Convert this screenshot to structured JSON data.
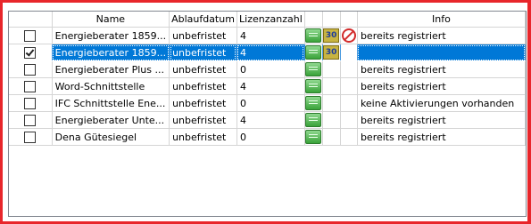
{
  "columns": {
    "check": "",
    "name": "Name",
    "ablaufdatum": "Ablaufdatum",
    "lizenzanzahl": "Lizenzanzahl",
    "icons": "",
    "info": "Info"
  },
  "rows": [
    {
      "checked": false,
      "name": "Energieberater 1859...",
      "ablaufdatum": "unbefristet",
      "lizenzanzahl": "4",
      "lic_icon": "license-icon",
      "days_icon": "30",
      "blocked_icon": "blocked-icon",
      "info": "bereits registriert"
    },
    {
      "checked": true,
      "name": "Energieberater 1859...",
      "ablaufdatum": "unbefristet",
      "lizenzanzahl": "4",
      "lic_icon": "license-icon",
      "days_icon": "30",
      "blocked_icon": "",
      "info": ""
    },
    {
      "checked": false,
      "name": "Energieberater Plus ...",
      "ablaufdatum": "unbefristet",
      "lizenzanzahl": "0",
      "lic_icon": "license-icon",
      "days_icon": "",
      "blocked_icon": "",
      "info": "bereits registriert"
    },
    {
      "checked": false,
      "name": "Word-Schnittstelle",
      "ablaufdatum": "unbefristet",
      "lizenzanzahl": "4",
      "lic_icon": "license-icon",
      "days_icon": "",
      "blocked_icon": "",
      "info": "bereits registriert"
    },
    {
      "checked": false,
      "name": "IFC Schnittstelle Ene...",
      "ablaufdatum": "unbefristet",
      "lizenzanzahl": "0",
      "lic_icon": "license-icon",
      "days_icon": "",
      "blocked_icon": "",
      "info": "keine Aktivierungen vorhanden"
    },
    {
      "checked": false,
      "name": "Energieberater Unte...",
      "ablaufdatum": "unbefristet",
      "lizenzanzahl": "4",
      "lic_icon": "license-icon",
      "days_icon": "",
      "blocked_icon": "",
      "info": "bereits registriert"
    },
    {
      "checked": false,
      "name": "Dena Gütesiegel",
      "ablaufdatum": "unbefristet",
      "lizenzanzahl": "0",
      "lic_icon": "license-icon",
      "days_icon": "",
      "blocked_icon": "",
      "info": "bereits registriert"
    }
  ],
  "selected_row": 1,
  "colors": {
    "frame": "#e8262b",
    "selection": "#0078d7",
    "license_icon": "#3aa33a"
  }
}
